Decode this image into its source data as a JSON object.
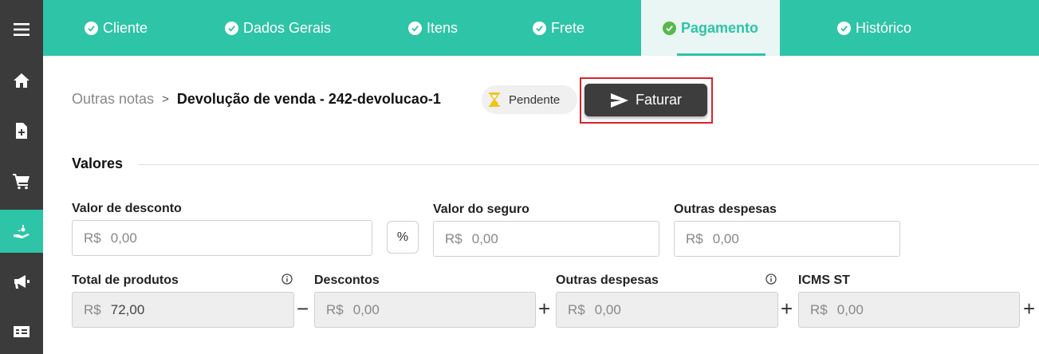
{
  "sidebar": {
    "items": [
      {
        "icon": "menu-icon"
      },
      {
        "icon": "home-icon"
      },
      {
        "icon": "new-document-icon"
      },
      {
        "icon": "cart-icon"
      },
      {
        "icon": "hand-money-icon",
        "active": true
      },
      {
        "icon": "megaphone-icon"
      },
      {
        "icon": "bill-icon"
      }
    ]
  },
  "tabs": [
    {
      "label": "Cliente"
    },
    {
      "label": "Dados Gerais"
    },
    {
      "label": "Itens"
    },
    {
      "label": "Frete"
    },
    {
      "label": "Pagamento",
      "active": true
    },
    {
      "label": "Histórico"
    }
  ],
  "breadcrumb": {
    "parent": "Outras notas",
    "separator": ">",
    "title": "Devolução de venda - 242-devolucao-1"
  },
  "status": {
    "label": "Pendente",
    "color": "#f2c318"
  },
  "faturar_button": {
    "label": "Faturar"
  },
  "section": {
    "title": "Valores"
  },
  "row1": {
    "desconto": {
      "label": "Valor de desconto",
      "currency": "R$",
      "placeholder": "0,00"
    },
    "percent_toggle": "%",
    "seguro": {
      "label": "Valor do seguro",
      "currency": "R$",
      "placeholder": "0,00"
    },
    "outras": {
      "label": "Outras despesas",
      "currency": "R$",
      "placeholder": "0,00"
    }
  },
  "row2": {
    "total_produtos": {
      "label": "Total de produtos",
      "currency": "R$",
      "value": "72,00"
    },
    "op1": "−",
    "descontos": {
      "label": "Descontos",
      "currency": "R$",
      "value": "0,00"
    },
    "op2": "+",
    "outras_despesas": {
      "label": "Outras despesas",
      "currency": "R$",
      "value": "0,00"
    },
    "op3": "+",
    "icms_st": {
      "label": "ICMS ST",
      "currency": "R$",
      "value": "0,00"
    },
    "op4": "+"
  },
  "colors": {
    "accent": "#2ec4a7",
    "sidebar": "#3b3b3b",
    "highlight": "#d8232a"
  }
}
